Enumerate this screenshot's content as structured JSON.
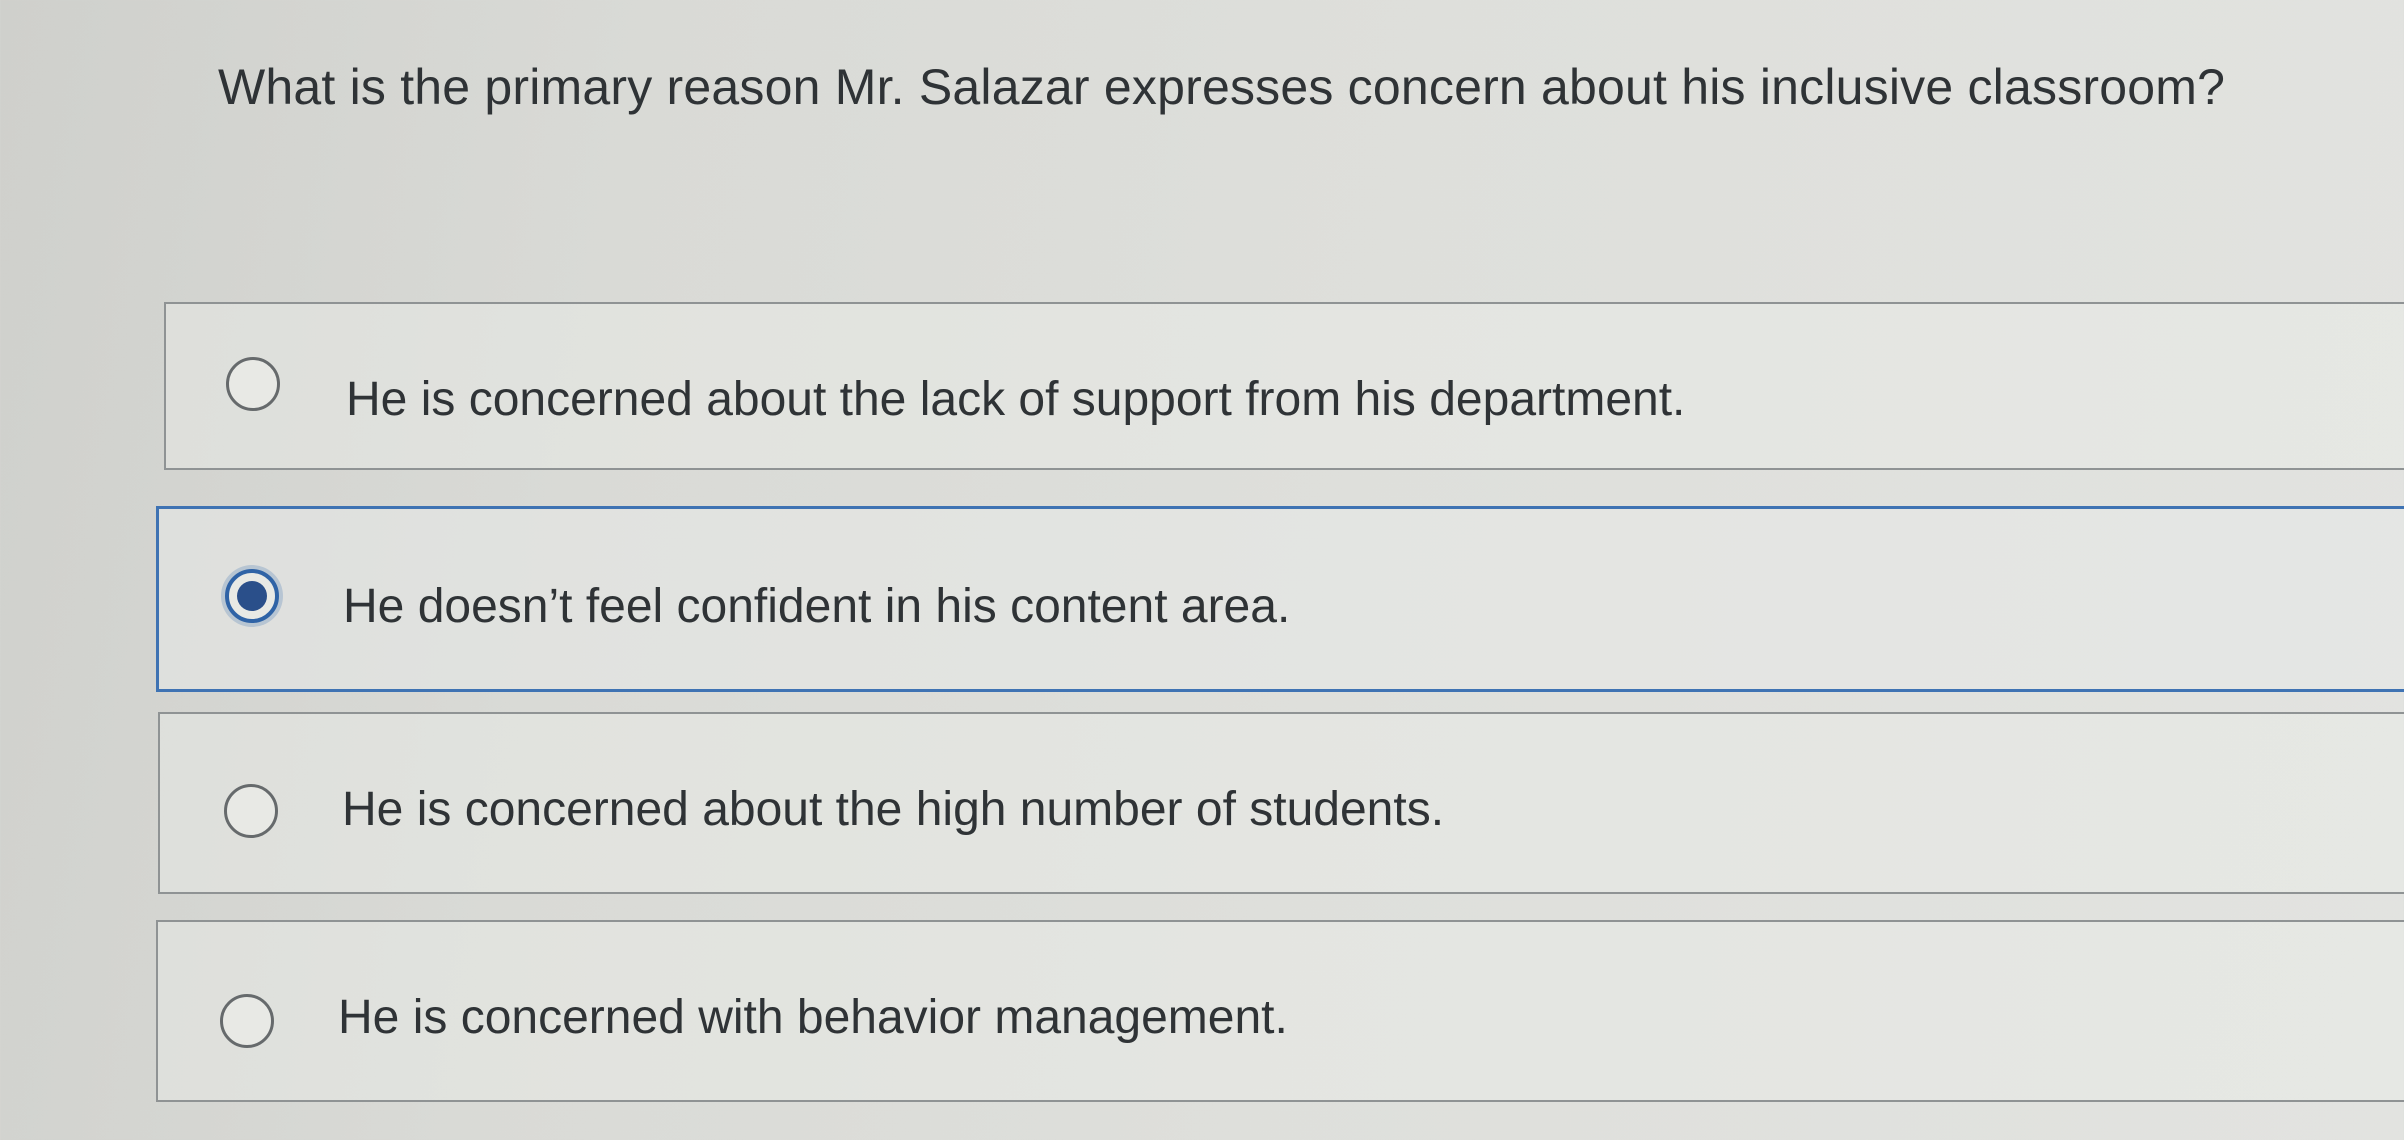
{
  "question": {
    "text": "What is the primary reason Mr. Salazar expresses concern about his inclusive classroom?"
  },
  "options": [
    {
      "label": "He is concerned about the lack of support from his department.",
      "selected": false
    },
    {
      "label": "He doesn’t feel confident in his content area.",
      "selected": true
    },
    {
      "label": "He is concerned about the high number of students.",
      "selected": false
    },
    {
      "label": "He is concerned with behavior management.",
      "selected": false
    }
  ],
  "colors": {
    "accent": "#3f73b3",
    "text": "#2f3336",
    "border": "#8f9394"
  }
}
